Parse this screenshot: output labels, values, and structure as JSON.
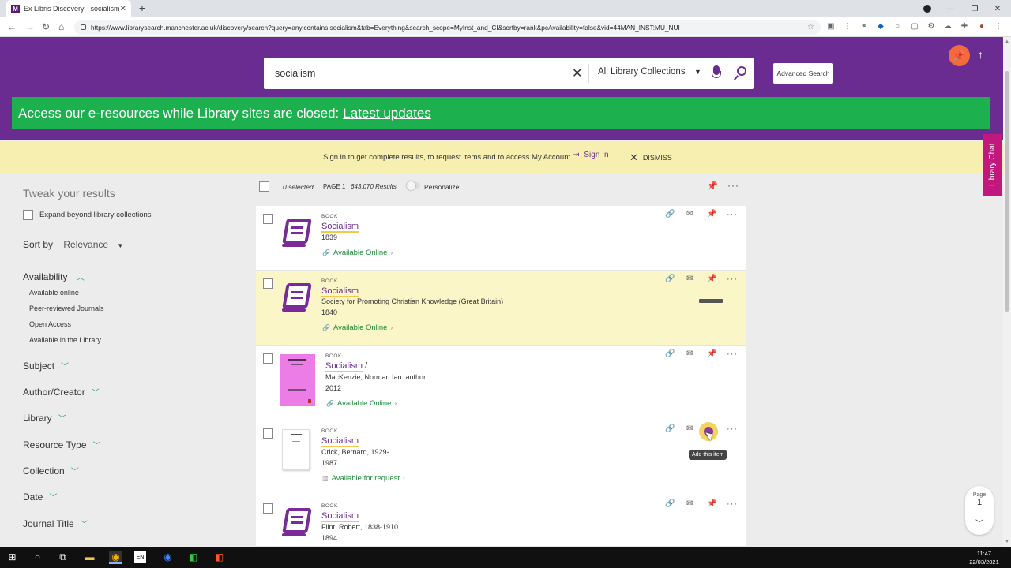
{
  "browser": {
    "tab_title": "Ex Libris Discovery - socialism",
    "tab_favicon": "M",
    "url": "https://www.librarysearch.manchester.ac.uk/discovery/search?query=any,contains,socialism&tab=Everything&search_scope=MyInst_and_CI&sortby=rank&pcAvailability=false&vid=44MAN_INST:MU_NUI"
  },
  "header": {
    "search_value": "socialism",
    "scope_label": "All Library Collections",
    "advanced_label": "Advanced Search",
    "banner_text": "Access our e-resources while Library sites are closed:",
    "banner_link": "Latest updates",
    "accent_color": "#6b2c91",
    "banner_color": "#1db04f"
  },
  "signin_bar": {
    "message": "Sign in to get complete results, to request items and to access My Account",
    "signin_label": "Sign In",
    "dismiss_label": "DISMISS"
  },
  "chat_label": "Library Chat",
  "facets": {
    "title": "Tweak your results",
    "expand_label": "Expand beyond library collections",
    "sort_label": "Sort by",
    "sort_value": "Relevance",
    "availability_label": "Availability",
    "availability_items": [
      "Available online",
      "Peer-reviewed Journals",
      "Open Access",
      "Available in the Library"
    ],
    "groups": [
      "Subject",
      "Author/Creator",
      "Library",
      "Resource Type",
      "Collection",
      "Date",
      "Journal Title"
    ]
  },
  "results_bar": {
    "selected": "0 selected",
    "page": "PAGE 1",
    "count": "643,070 Results",
    "personalize": "Personalize"
  },
  "results": [
    {
      "type": "BOOK",
      "title": "Socialism",
      "suffix": "",
      "lines": [
        "1839"
      ],
      "availability": "Available Online"
    },
    {
      "type": "BOOK",
      "title": "Socialism",
      "suffix": "",
      "lines": [
        "Society for Promoting Christian Knowledge (Great Britain)",
        "1840"
      ],
      "availability": "Available Online"
    },
    {
      "type": "BOOK",
      "title": "Socialism",
      "suffix": "/",
      "lines": [
        "MacKenzie, Norman Ian. author.",
        "2012"
      ],
      "availability": "Available Online"
    },
    {
      "type": "BOOK",
      "title": "Socialism",
      "suffix": "",
      "lines": [
        "Crick, Bernard, 1929-",
        "1987."
      ],
      "availability": "Available for request"
    },
    {
      "type": "BOOK",
      "title": "Socialism",
      "suffix": "",
      "lines": [
        "Flint, Robert, 1838-1910.",
        "1894."
      ],
      "availability": ""
    }
  ],
  "tooltip": "Add this item",
  "page_indicator": {
    "label": "Page",
    "number": "1"
  },
  "taskbar": {
    "time": "11:47",
    "date": "22/03/2021",
    "lang": "EN"
  }
}
